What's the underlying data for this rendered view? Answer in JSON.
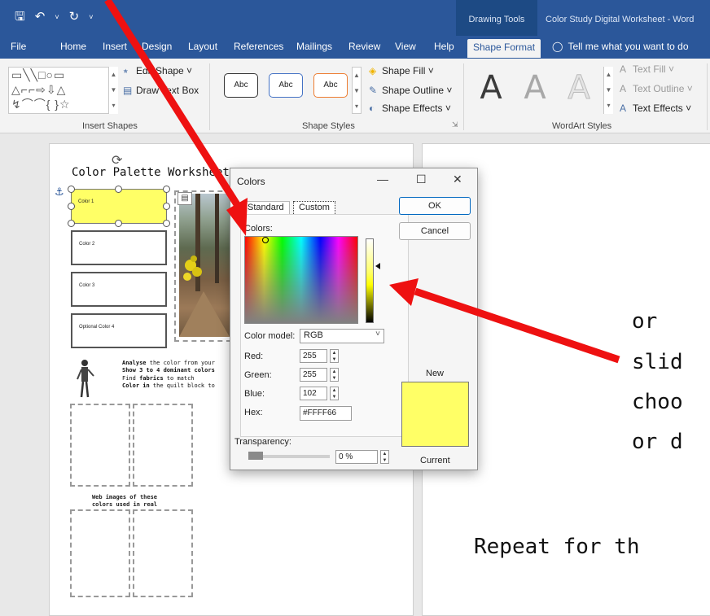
{
  "app": {
    "doc_title": "Color Study Digital Worksheet - Word",
    "context_tab_group": "Drawing Tools"
  },
  "quick_access": {
    "save_icon": "save-icon",
    "undo_icon": "undo-icon",
    "redo_icon": "redo-icon",
    "customize_icon": "chevron-down-icon"
  },
  "tabs": [
    {
      "label": "File"
    },
    {
      "label": "Home"
    },
    {
      "label": "Insert"
    },
    {
      "label": "Design"
    },
    {
      "label": "Layout"
    },
    {
      "label": "References"
    },
    {
      "label": "Mailings"
    },
    {
      "label": "Review"
    },
    {
      "label": "View"
    },
    {
      "label": "Help"
    },
    {
      "label": "Shape Format"
    }
  ],
  "tell_me": "Tell me what you want to do",
  "ribbon": {
    "insert_shapes": {
      "group_label": "Insert Shapes",
      "edit_shape": "Edit Shape",
      "draw_text_box": "Draw Text Box"
    },
    "shape_styles": {
      "group_label": "Shape Styles",
      "style_label": "Abc",
      "shape_fill": "Shape Fill",
      "shape_outline": "Shape Outline",
      "shape_effects": "Shape Effects"
    },
    "wordart_styles": {
      "group_label": "WordArt Styles",
      "letter": "A",
      "text_fill": "Text Fill",
      "text_outline": "Text Outline",
      "text_effects": "Text Effects"
    }
  },
  "worksheet": {
    "title": "Color Palette Worksheet",
    "color_boxes": [
      "Color 1",
      "Color 2",
      "Color 3",
      "Optional Color 4"
    ],
    "instructions": [
      {
        "bold": "Analyse",
        "rest": " the color from your"
      },
      {
        "bold": "Show 3 to 4 dominant colors",
        "rest": ""
      },
      {
        "bold": "",
        "rest": "Find "
      },
      {
        "bold": "Color in",
        "rest": " the quilt block to"
      }
    ],
    "find_bold": "fabrics",
    "find_rest": " to match",
    "web_images_line1": "Web images of these",
    "web_images_line2": "colors used in real",
    "right_text": [
      "or",
      "slid",
      "choo",
      "or d"
    ],
    "repeat_text": "Repeat for th"
  },
  "colors_dialog": {
    "title": "Colors",
    "tab_standard": "Standard",
    "tab_custom": "Custom",
    "colors_label": "Colors:",
    "color_model_label": "Color model:",
    "color_model_value": "RGB",
    "red_label": "Red:",
    "red_value": "255",
    "green_label": "Green:",
    "green_value": "255",
    "blue_label": "Blue:",
    "blue_value": "102",
    "hex_label": "Hex:",
    "hex_value": "#FFFF66",
    "transparency_label": "Transparency:",
    "transparency_value": "0 %",
    "ok": "OK",
    "cancel": "Cancel",
    "new_label": "New",
    "current_label": "Current",
    "selected_color": "#FFFF66"
  },
  "colors": {
    "word_blue": "#2b579a",
    "annotation_red": "#ee1111",
    "selected_fill": "#ffff66"
  }
}
